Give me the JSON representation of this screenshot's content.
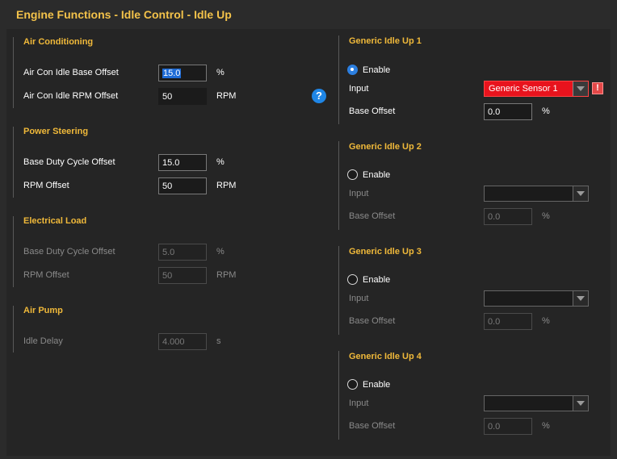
{
  "page": {
    "title": "Engine Functions - Idle Control - Idle Up"
  },
  "air_conditioning": {
    "title": "Air Conditioning",
    "base_offset_label": "Air Con Idle Base Offset",
    "base_offset_value": "15.0",
    "base_offset_unit": "%",
    "rpm_offset_label": "Air Con Idle RPM Offset",
    "rpm_offset_value": "50",
    "rpm_offset_unit": "RPM"
  },
  "power_steering": {
    "title": "Power Steering",
    "duty_label": "Base Duty Cycle Offset",
    "duty_value": "15.0",
    "duty_unit": "%",
    "rpm_label": "RPM Offset",
    "rpm_value": "50",
    "rpm_unit": "RPM"
  },
  "electrical_load": {
    "title": "Electrical Load",
    "duty_label": "Base Duty Cycle Offset",
    "duty_value": "5.0",
    "duty_unit": "%",
    "rpm_label": "RPM Offset",
    "rpm_value": "50",
    "rpm_unit": "RPM"
  },
  "air_pump": {
    "title": "Air Pump",
    "delay_label": "Idle Delay",
    "delay_value": "4.000",
    "delay_unit": "s"
  },
  "help_icon": "?",
  "generic": [
    {
      "title": "Generic Idle Up 1",
      "enable_label": "Enable",
      "enabled": true,
      "input_label": "Input",
      "input_value": "Generic Sensor 1",
      "base_offset_label": "Base Offset",
      "base_offset_value": "0.0",
      "unit": "%",
      "warning": "!"
    },
    {
      "title": "Generic Idle Up 2",
      "enable_label": "Enable",
      "enabled": false,
      "input_label": "Input",
      "input_value": "",
      "base_offset_label": "Base Offset",
      "base_offset_value": "0.0",
      "unit": "%"
    },
    {
      "title": "Generic Idle Up 3",
      "enable_label": "Enable",
      "enabled": false,
      "input_label": "Input",
      "input_value": "",
      "base_offset_label": "Base Offset",
      "base_offset_value": "0.0",
      "unit": "%"
    },
    {
      "title": "Generic Idle Up 4",
      "enable_label": "Enable",
      "enabled": false,
      "input_label": "Input",
      "input_value": "",
      "base_offset_label": "Base Offset",
      "base_offset_value": "0.0",
      "unit": "%"
    }
  ],
  "colors": {
    "accent_title": "#f3c24a",
    "section_title": "#f0b93a",
    "error_red": "#e8131d",
    "radio_blue": "#2c7fe0"
  }
}
